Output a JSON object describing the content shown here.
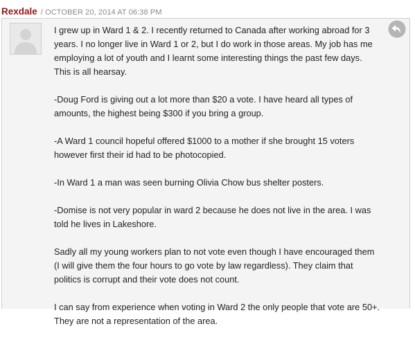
{
  "comment": {
    "author": "Rexdale",
    "separator": "/",
    "date": "OCTOBER 20, 2014 AT 06:38 PM",
    "avatar_icon": "default-user-icon",
    "reply_icon": "reply-arrow-icon",
    "paragraphs": [
      "I grew up in Ward 1 & 2. I recently returned to Canada after working abroad for 3 years. I no longer live in Ward 1 or 2, but I do work in those areas. My job has me employing a lot of youth and I learnt some interesting things the past few days. This is all hearsay.",
      "-Doug Ford is giving out a lot more than $20 a vote. I have heard all types of amounts, the highest being $300 if you bring a group.",
      "-A Ward 1 council hopeful offered $1000 to a mother if she brought 15 voters however first their id had to be photocopied.",
      "-In Ward 1 a man was seen burning Olivia Chow bus shelter posters.",
      "-Domise is not very popular in ward 2 because he does not live in the area. I was told he lives in Lakeshore.",
      "Sadly all my young workers plan to not vote even though I have encouraged them (I will give them the four hours to go vote by law regardless). They claim that politics is corrupt and their vote does not count.",
      "I can say from experience when voting in Ward 2 the only people that vote are 50+. They are not a representation of the area."
    ]
  },
  "colors": {
    "author": "#8b1a1a",
    "meta": "#8a8a8a",
    "body_text": "#222222",
    "box_background": "#f4f4f4",
    "box_border": "#d0d0d0",
    "reply_icon": "#b5b5b5"
  }
}
